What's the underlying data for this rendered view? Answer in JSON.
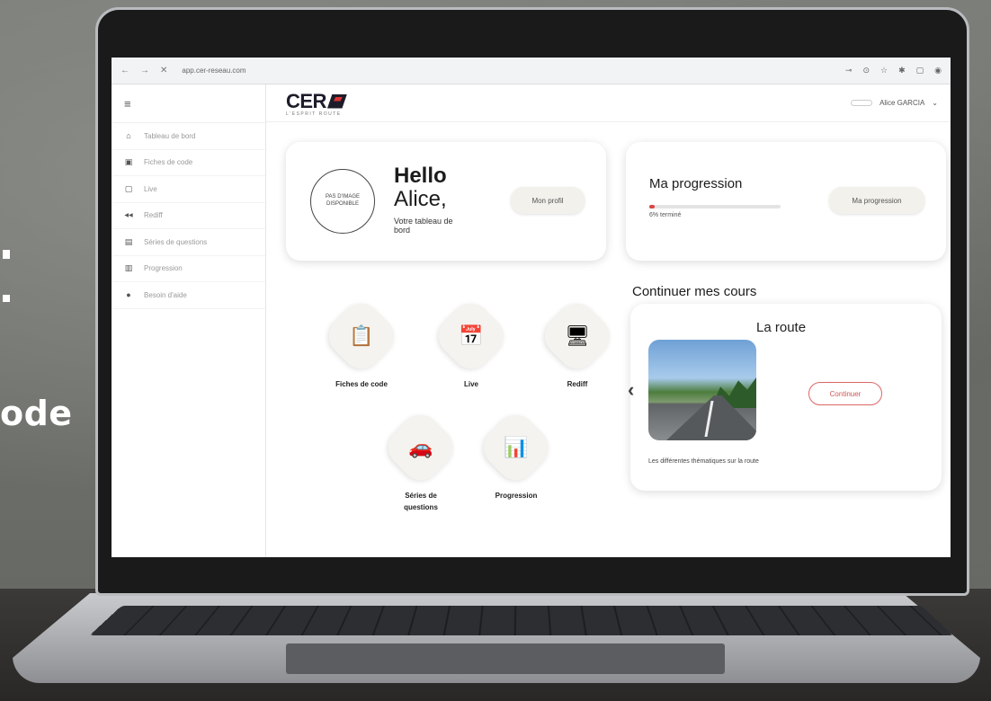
{
  "side_text": "ode",
  "browser": {
    "url": "app.cer-reseau.com",
    "nav": [
      "←",
      "→",
      "✕"
    ]
  },
  "sidebar": {
    "menu_icon": "≡",
    "items": [
      {
        "label": "Tableau de bord",
        "icon": "home-icon",
        "glyph": "⌂"
      },
      {
        "label": "Fiches de code",
        "icon": "book-icon",
        "glyph": "▣"
      },
      {
        "label": "Live",
        "icon": "screen-icon",
        "glyph": "▢"
      },
      {
        "label": "Rediff",
        "icon": "rewind-icon",
        "glyph": "◀◀"
      },
      {
        "label": "Séries de questions",
        "icon": "list-icon",
        "glyph": "▤"
      },
      {
        "label": "Progression",
        "icon": "chart-icon",
        "glyph": "▥"
      },
      {
        "label": "Besoin d'aide",
        "icon": "help-icon",
        "glyph": "●"
      }
    ]
  },
  "header": {
    "logo_text": "CER",
    "logo_sub": "L'ESPRIT ROUTE",
    "user_name": "Alice GARCIA",
    "user_chevron": "⌄"
  },
  "hello": {
    "avatar_placeholder": "PAS D'IMAGE DISPONIBLE",
    "title": "Hello",
    "name": "Alice,",
    "subtitle": "Votre tableau de bord",
    "profile_button": "Mon profil"
  },
  "progression": {
    "title": "Ma progression",
    "percent": 4,
    "label": "6% terminé",
    "button": "Ma progression"
  },
  "tiles": [
    {
      "label": "Fiches de code",
      "icon": "fiches-icon",
      "glyph": "📋"
    },
    {
      "label": "Live",
      "icon": "live-icon",
      "glyph": "📅"
    },
    {
      "label": "Rediff",
      "icon": "rediff-icon",
      "glyph": "🖥"
    },
    {
      "label": "Séries de questions",
      "icon": "series-icon",
      "glyph": "🚗"
    },
    {
      "label": "Progression",
      "icon": "progression-icon",
      "glyph": "📊"
    }
  ],
  "courses": {
    "section_title": "Continuer mes cours",
    "name": "La route",
    "button": "Continuer",
    "description": "Les différentes thématiques sur la route",
    "prev": "‹",
    "next": "›"
  }
}
